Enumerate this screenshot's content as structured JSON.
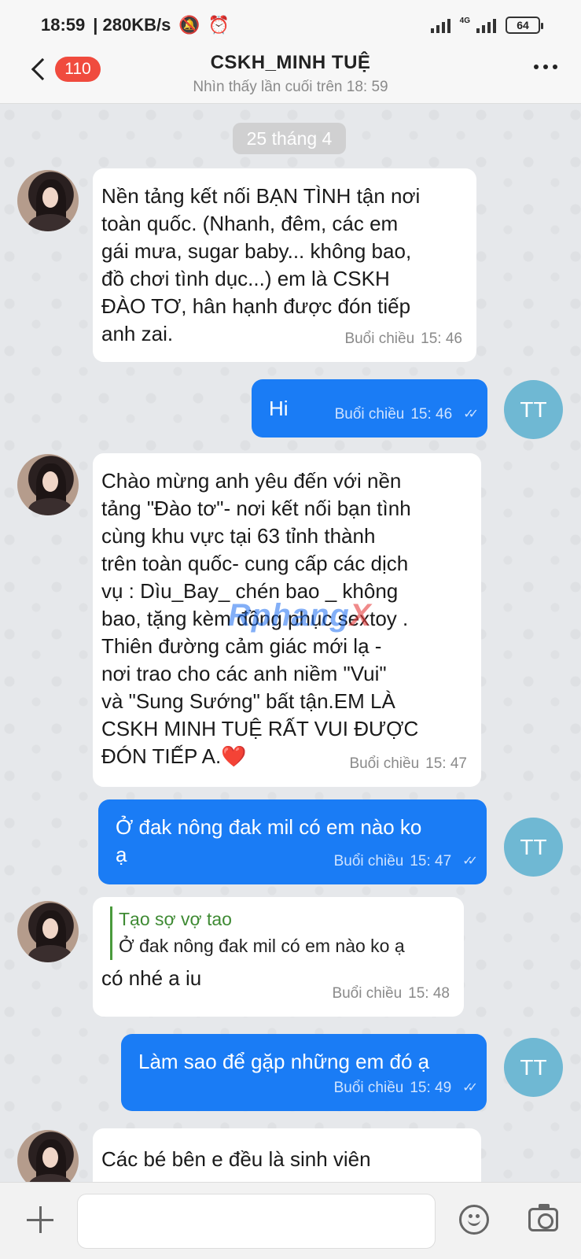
{
  "status_bar": {
    "time": "18:59",
    "speed": "| 280KB/s",
    "network": "4G",
    "battery": "64"
  },
  "header": {
    "unread_count": "110",
    "title": "CSKH_MINH TUỆ",
    "subtitle": "Nhìn thấy lần cuối trên 18: 59"
  },
  "date_label": "25 tháng 4",
  "watermark": {
    "part1": "Rphang",
    "part2": "X"
  },
  "outgoing_avatar_initials": "TT",
  "messages": [
    {
      "side": "incoming",
      "text": "Nền tảng kết nối BẠN TÌNH tận nơi\ntoàn quốc. (Nhanh, đêm, các em\ngái mưa, sugar baby... không bao,\nđồ chơi tình dục...) em là CSKH\nĐÀO TƠ, hân hạnh được đón tiếp\nanh zai.",
      "period": "Buổi chiều",
      "time": "15: 46"
    },
    {
      "side": "outgoing",
      "text": "Hi",
      "period": "Buổi chiều",
      "time": "15: 46"
    },
    {
      "side": "incoming",
      "text": "Chào mừng anh yêu đến với nền\ntảng \"Đào tơ\"- nơi kết nối bạn tình\ncùng khu vực tại 63 tỉnh thành\ntrên toàn quốc- cung cấp các dịch\nvụ : Dìu_Bay_ chén bao _ không\nbao, tặng kèm đồng phục sextoy .\nThiên đường cảm giác mới lạ -\nnơi trao cho các anh niềm \"Vui\"\nvà \"Sung Sướng\" bất tận.EM LÀ\nCSKH MINH TUỆ RẤT VUI ĐƯỢC\nĐÓN TIẾP A.❤️",
      "period": "Buổi chiều",
      "time": "15: 47"
    },
    {
      "side": "outgoing",
      "text": "Ở đak nông đak mil có em nào ko\nạ",
      "period": "Buổi chiều",
      "time": "15: 47"
    },
    {
      "side": "incoming",
      "quote_author": "Tạo sợ vợ tao",
      "quote_text": "Ở đak nông đak mil có em nào ko ạ",
      "text": "có nhé a iu",
      "period": "Buổi chiều",
      "time": "15: 48"
    },
    {
      "side": "outgoing",
      "text": "Làm sao để gặp những em đó ạ",
      "period": "Buổi chiều",
      "time": "15: 49"
    },
    {
      "side": "incoming",
      "text": "Các bé bên e đều là sinh viên"
    }
  ],
  "input": {
    "placeholder": ""
  },
  "icons": {
    "back": "back-arrow-icon",
    "more": "more-vertical-dots-icon",
    "plus": "plus-icon",
    "emoji": "emoji-icon",
    "camera": "camera-icon",
    "read": "double-check-icon"
  },
  "colors": {
    "outgoing_bubble": "#1a7cf5",
    "badge": "#f04b3e",
    "tt_avatar": "#6fb8d3",
    "quote_accent": "#3e8a33"
  }
}
